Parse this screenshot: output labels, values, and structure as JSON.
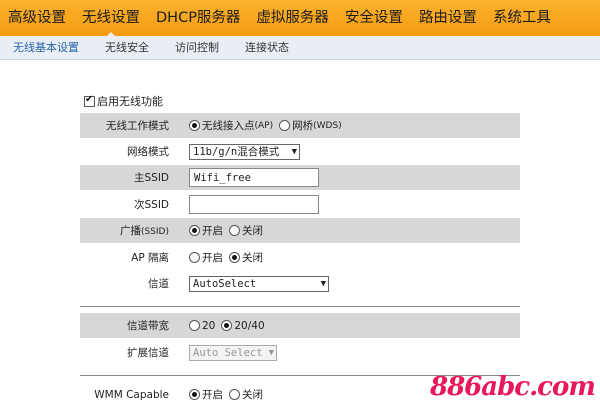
{
  "topnav": {
    "items": [
      "高级设置",
      "无线设置",
      "DHCP服务器",
      "虚拟服务器",
      "安全设置",
      "路由设置",
      "系统工具"
    ]
  },
  "subnav": {
    "tabs": [
      "无线基本设置",
      "无线安全",
      "访问控制",
      "连接状态"
    ]
  },
  "form": {
    "enable_label": "启用无线功能",
    "mode": {
      "label": "无线工作模式",
      "opt1": "无线接入点",
      "opt1_sub": "(AP)",
      "opt2": "网桥",
      "opt2_sub": "(WDS)"
    },
    "netmode": {
      "label": "网络模式",
      "value": "11b/g/n混合模式"
    },
    "ssid1": {
      "label": "主SSID",
      "value": "Wifi_free"
    },
    "ssid2": {
      "label": "次SSID",
      "value": ""
    },
    "broadcast": {
      "label": "广播",
      "label_sub": "(SSID)",
      "on": "开启",
      "off": "关闭"
    },
    "ap_isolation": {
      "label": "AP 隔离",
      "on": "开启",
      "off": "关闭"
    },
    "channel": {
      "label": "信道",
      "value": "AutoSelect"
    },
    "bandwidth": {
      "label": "信道带宽",
      "opt1": "20",
      "opt2": "20/40"
    },
    "ext_channel": {
      "label": "扩展信道",
      "value": "Auto Select"
    },
    "wmm": {
      "label": "WMM Capable",
      "on": "开启",
      "off": "关闭"
    }
  },
  "watermark": {
    "text": "886abc.com"
  },
  "colors": {
    "nav": "#f7a51f",
    "shade": "#d7d7d7",
    "watermark": "#e8195a"
  }
}
